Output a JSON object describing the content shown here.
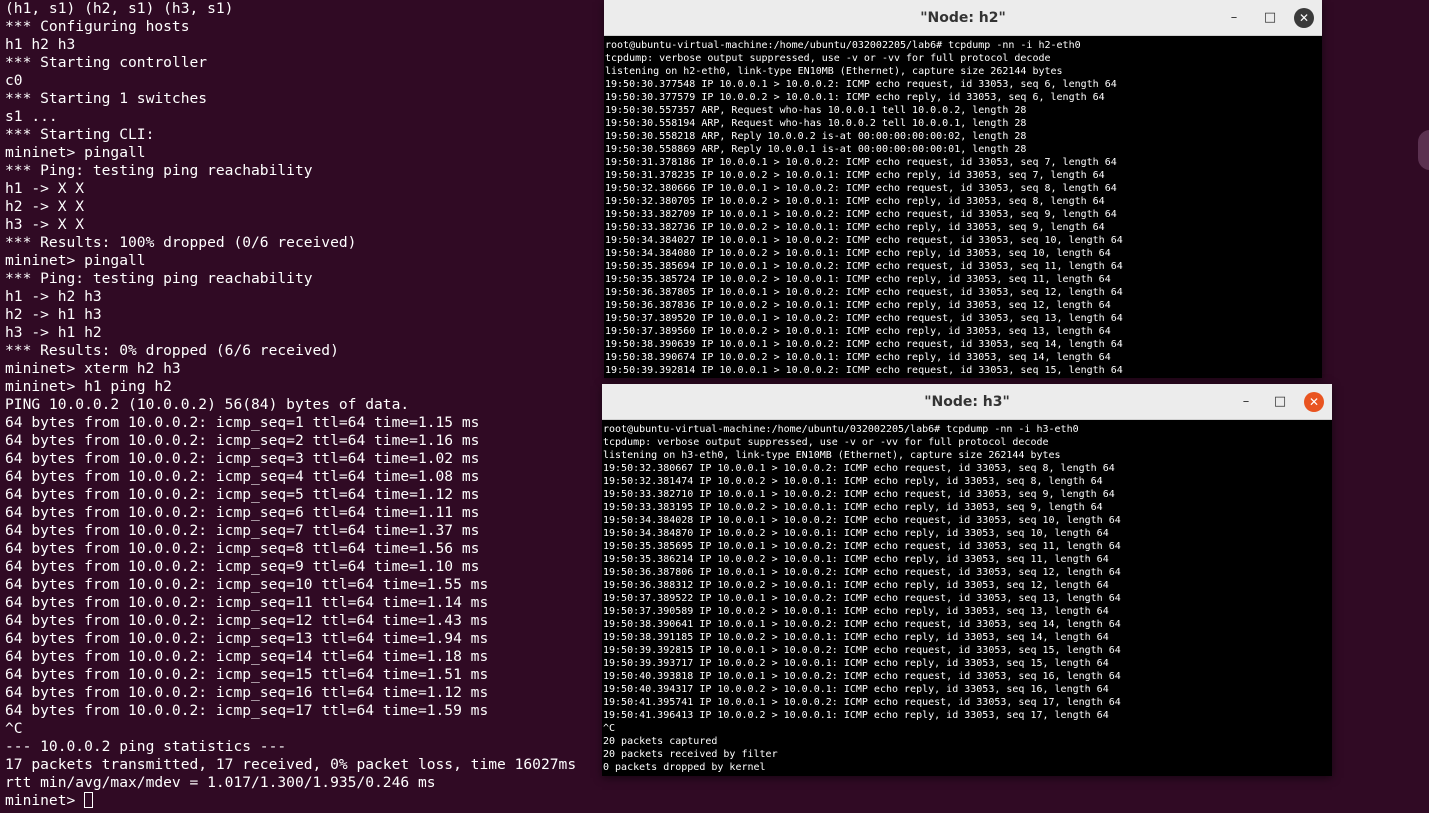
{
  "main_terminal": {
    "lines": [
      "(h1, s1) (h2, s1) (h3, s1)",
      "*** Configuring hosts",
      "h1 h2 h3",
      "*** Starting controller",
      "c0",
      "*** Starting 1 switches",
      "s1 ...",
      "*** Starting CLI:",
      "mininet> pingall",
      "*** Ping: testing ping reachability",
      "h1 -> X X",
      "h2 -> X X",
      "h3 -> X X",
      "*** Results: 100% dropped (0/6 received)",
      "mininet> pingall",
      "*** Ping: testing ping reachability",
      "h1 -> h2 h3",
      "h2 -> h1 h3",
      "h3 -> h1 h2",
      "*** Results: 0% dropped (6/6 received)",
      "mininet> xterm h2 h3",
      "mininet> h1 ping h2",
      "PING 10.0.0.2 (10.0.0.2) 56(84) bytes of data.",
      "64 bytes from 10.0.0.2: icmp_seq=1 ttl=64 time=1.15 ms",
      "64 bytes from 10.0.0.2: icmp_seq=2 ttl=64 time=1.16 ms",
      "64 bytes from 10.0.0.2: icmp_seq=3 ttl=64 time=1.02 ms",
      "64 bytes from 10.0.0.2: icmp_seq=4 ttl=64 time=1.08 ms",
      "64 bytes from 10.0.0.2: icmp_seq=5 ttl=64 time=1.12 ms",
      "64 bytes from 10.0.0.2: icmp_seq=6 ttl=64 time=1.11 ms",
      "64 bytes from 10.0.0.2: icmp_seq=7 ttl=64 time=1.37 ms",
      "64 bytes from 10.0.0.2: icmp_seq=8 ttl=64 time=1.56 ms",
      "64 bytes from 10.0.0.2: icmp_seq=9 ttl=64 time=1.10 ms",
      "64 bytes from 10.0.0.2: icmp_seq=10 ttl=64 time=1.55 ms",
      "64 bytes from 10.0.0.2: icmp_seq=11 ttl=64 time=1.14 ms",
      "64 bytes from 10.0.0.2: icmp_seq=12 ttl=64 time=1.43 ms",
      "64 bytes from 10.0.0.2: icmp_seq=13 ttl=64 time=1.94 ms",
      "64 bytes from 10.0.0.2: icmp_seq=14 ttl=64 time=1.18 ms",
      "64 bytes from 10.0.0.2: icmp_seq=15 ttl=64 time=1.51 ms",
      "64 bytes from 10.0.0.2: icmp_seq=16 ttl=64 time=1.12 ms",
      "64 bytes from 10.0.0.2: icmp_seq=17 ttl=64 time=1.59 ms",
      "^C",
      "--- 10.0.0.2 ping statistics ---",
      "17 packets transmitted, 17 received, 0% packet loss, time 16027ms",
      "rtt min/avg/max/mdev = 1.017/1.300/1.935/0.246 ms"
    ],
    "prompt": "mininet> "
  },
  "xterm_h2": {
    "title": "\"Node: h2\"",
    "lines": [
      "root@ubuntu-virtual-machine:/home/ubuntu/032002205/lab6# tcpdump -nn -i h2-eth0",
      "tcpdump: verbose output suppressed, use -v or -vv for full protocol decode",
      "listening on h2-eth0, link-type EN10MB (Ethernet), capture size 262144 bytes",
      "19:50:30.377548 IP 10.0.0.1 > 10.0.0.2: ICMP echo request, id 33053, seq 6, length 64",
      "19:50:30.377579 IP 10.0.0.2 > 10.0.0.1: ICMP echo reply, id 33053, seq 6, length 64",
      "19:50:30.557357 ARP, Request who-has 10.0.0.1 tell 10.0.0.2, length 28",
      "19:50:30.558194 ARP, Request who-has 10.0.0.2 tell 10.0.0.1, length 28",
      "19:50:30.558218 ARP, Reply 10.0.0.2 is-at 00:00:00:00:00:02, length 28",
      "19:50:30.558869 ARP, Reply 10.0.0.1 is-at 00:00:00:00:00:01, length 28",
      "19:50:31.378186 IP 10.0.0.1 > 10.0.0.2: ICMP echo request, id 33053, seq 7, length 64",
      "19:50:31.378235 IP 10.0.0.2 > 10.0.0.1: ICMP echo reply, id 33053, seq 7, length 64",
      "19:50:32.380666 IP 10.0.0.1 > 10.0.0.2: ICMP echo request, id 33053, seq 8, length 64",
      "19:50:32.380705 IP 10.0.0.2 > 10.0.0.1: ICMP echo reply, id 33053, seq 8, length 64",
      "19:50:33.382709 IP 10.0.0.1 > 10.0.0.2: ICMP echo request, id 33053, seq 9, length 64",
      "19:50:33.382736 IP 10.0.0.2 > 10.0.0.1: ICMP echo reply, id 33053, seq 9, length 64",
      "19:50:34.384027 IP 10.0.0.1 > 10.0.0.2: ICMP echo request, id 33053, seq 10, length 64",
      "19:50:34.384080 IP 10.0.0.2 > 10.0.0.1: ICMP echo reply, id 33053, seq 10, length 64",
      "19:50:35.385694 IP 10.0.0.1 > 10.0.0.2: ICMP echo request, id 33053, seq 11, length 64",
      "19:50:35.385724 IP 10.0.0.2 > 10.0.0.1: ICMP echo reply, id 33053, seq 11, length 64",
      "19:50:36.387805 IP 10.0.0.1 > 10.0.0.2: ICMP echo request, id 33053, seq 12, length 64",
      "19:50:36.387836 IP 10.0.0.2 > 10.0.0.1: ICMP echo reply, id 33053, seq 12, length 64",
      "19:50:37.389520 IP 10.0.0.1 > 10.0.0.2: ICMP echo request, id 33053, seq 13, length 64",
      "19:50:37.389560 IP 10.0.0.2 > 10.0.0.1: ICMP echo reply, id 33053, seq 13, length 64",
      "19:50:38.390639 IP 10.0.0.1 > 10.0.0.2: ICMP echo request, id 33053, seq 14, length 64",
      "19:50:38.390674 IP 10.0.0.2 > 10.0.0.1: ICMP echo reply, id 33053, seq 14, length 64",
      "19:50:39.392814 IP 10.0.0.1 > 10.0.0.2: ICMP echo request, id 33053, seq 15, length 64"
    ],
    "buttons": {
      "minimize": "–",
      "maximize": "□",
      "close": "✕"
    },
    "close_color": "#3a3a3a"
  },
  "xterm_h3": {
    "title": "\"Node: h3\"",
    "lines": [
      "root@ubuntu-virtual-machine:/home/ubuntu/032002205/lab6# tcpdump -nn -i h3-eth0",
      "tcpdump: verbose output suppressed, use -v or -vv for full protocol decode",
      "listening on h3-eth0, link-type EN10MB (Ethernet), capture size 262144 bytes",
      "19:50:32.380667 IP 10.0.0.1 > 10.0.0.2: ICMP echo request, id 33053, seq 8, length 64",
      "19:50:32.381474 IP 10.0.0.2 > 10.0.0.1: ICMP echo reply, id 33053, seq 8, length 64",
      "19:50:33.382710 IP 10.0.0.1 > 10.0.0.2: ICMP echo request, id 33053, seq 9, length 64",
      "19:50:33.383195 IP 10.0.0.2 > 10.0.0.1: ICMP echo reply, id 33053, seq 9, length 64",
      "19:50:34.384028 IP 10.0.0.1 > 10.0.0.2: ICMP echo request, id 33053, seq 10, length 64",
      "19:50:34.384870 IP 10.0.0.2 > 10.0.0.1: ICMP echo reply, id 33053, seq 10, length 64",
      "19:50:35.385695 IP 10.0.0.1 > 10.0.0.2: ICMP echo request, id 33053, seq 11, length 64",
      "19:50:35.386214 IP 10.0.0.2 > 10.0.0.1: ICMP echo reply, id 33053, seq 11, length 64",
      "19:50:36.387806 IP 10.0.0.1 > 10.0.0.2: ICMP echo request, id 33053, seq 12, length 64",
      "19:50:36.388312 IP 10.0.0.2 > 10.0.0.1: ICMP echo reply, id 33053, seq 12, length 64",
      "19:50:37.389522 IP 10.0.0.1 > 10.0.0.2: ICMP echo request, id 33053, seq 13, length 64",
      "19:50:37.390589 IP 10.0.0.2 > 10.0.0.1: ICMP echo reply, id 33053, seq 13, length 64",
      "19:50:38.390641 IP 10.0.0.1 > 10.0.0.2: ICMP echo request, id 33053, seq 14, length 64",
      "19:50:38.391185 IP 10.0.0.2 > 10.0.0.1: ICMP echo reply, id 33053, seq 14, length 64",
      "19:50:39.392815 IP 10.0.0.1 > 10.0.0.2: ICMP echo request, id 33053, seq 15, length 64",
      "19:50:39.393717 IP 10.0.0.2 > 10.0.0.1: ICMP echo reply, id 33053, seq 15, length 64",
      "19:50:40.393818 IP 10.0.0.1 > 10.0.0.2: ICMP echo request, id 33053, seq 16, length 64",
      "19:50:40.394317 IP 10.0.0.2 > 10.0.0.1: ICMP echo reply, id 33053, seq 16, length 64",
      "19:50:41.395741 IP 10.0.0.1 > 10.0.0.2: ICMP echo request, id 33053, seq 17, length 64",
      "19:50:41.396413 IP 10.0.0.2 > 10.0.0.1: ICMP echo reply, id 33053, seq 17, length 64",
      "^C",
      "20 packets captured",
      "20 packets received by filter",
      "0 packets dropped by kernel"
    ],
    "buttons": {
      "minimize": "–",
      "maximize": "□",
      "close": "✕"
    },
    "close_color": "#e95420"
  }
}
